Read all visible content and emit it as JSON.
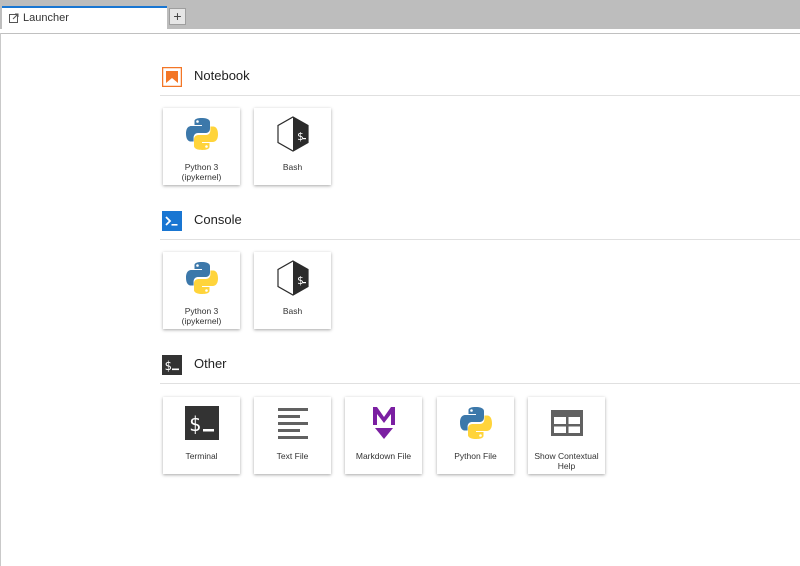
{
  "tabs": [
    {
      "label": "Launcher"
    }
  ],
  "add_tab": "+",
  "sections": {
    "notebook": {
      "title": "Notebook",
      "items": [
        {
          "label": "Python 3\n(ipykernel)",
          "icon": "python-icon"
        },
        {
          "label": "Bash",
          "icon": "bash-icon"
        }
      ]
    },
    "console": {
      "title": "Console",
      "items": [
        {
          "label": "Python 3\n(ipykernel)",
          "icon": "python-icon"
        },
        {
          "label": "Bash",
          "icon": "bash-icon"
        }
      ]
    },
    "other": {
      "title": "Other",
      "items": [
        {
          "label": "Terminal",
          "icon": "terminal-icon"
        },
        {
          "label": "Text File",
          "icon": "text-file-icon"
        },
        {
          "label": "Markdown File",
          "icon": "markdown-icon"
        },
        {
          "label": "Python File",
          "icon": "python-icon"
        },
        {
          "label": "Show Contextual Help",
          "icon": "contextual-help-icon"
        }
      ]
    }
  },
  "colors": {
    "notebook_accent": "#f37626",
    "console_accent": "#1976d2",
    "other_accent": "#333333",
    "markdown_accent": "#7b1fa2",
    "python_blue": "#3c78aa",
    "python_yellow": "#ffd43b"
  }
}
